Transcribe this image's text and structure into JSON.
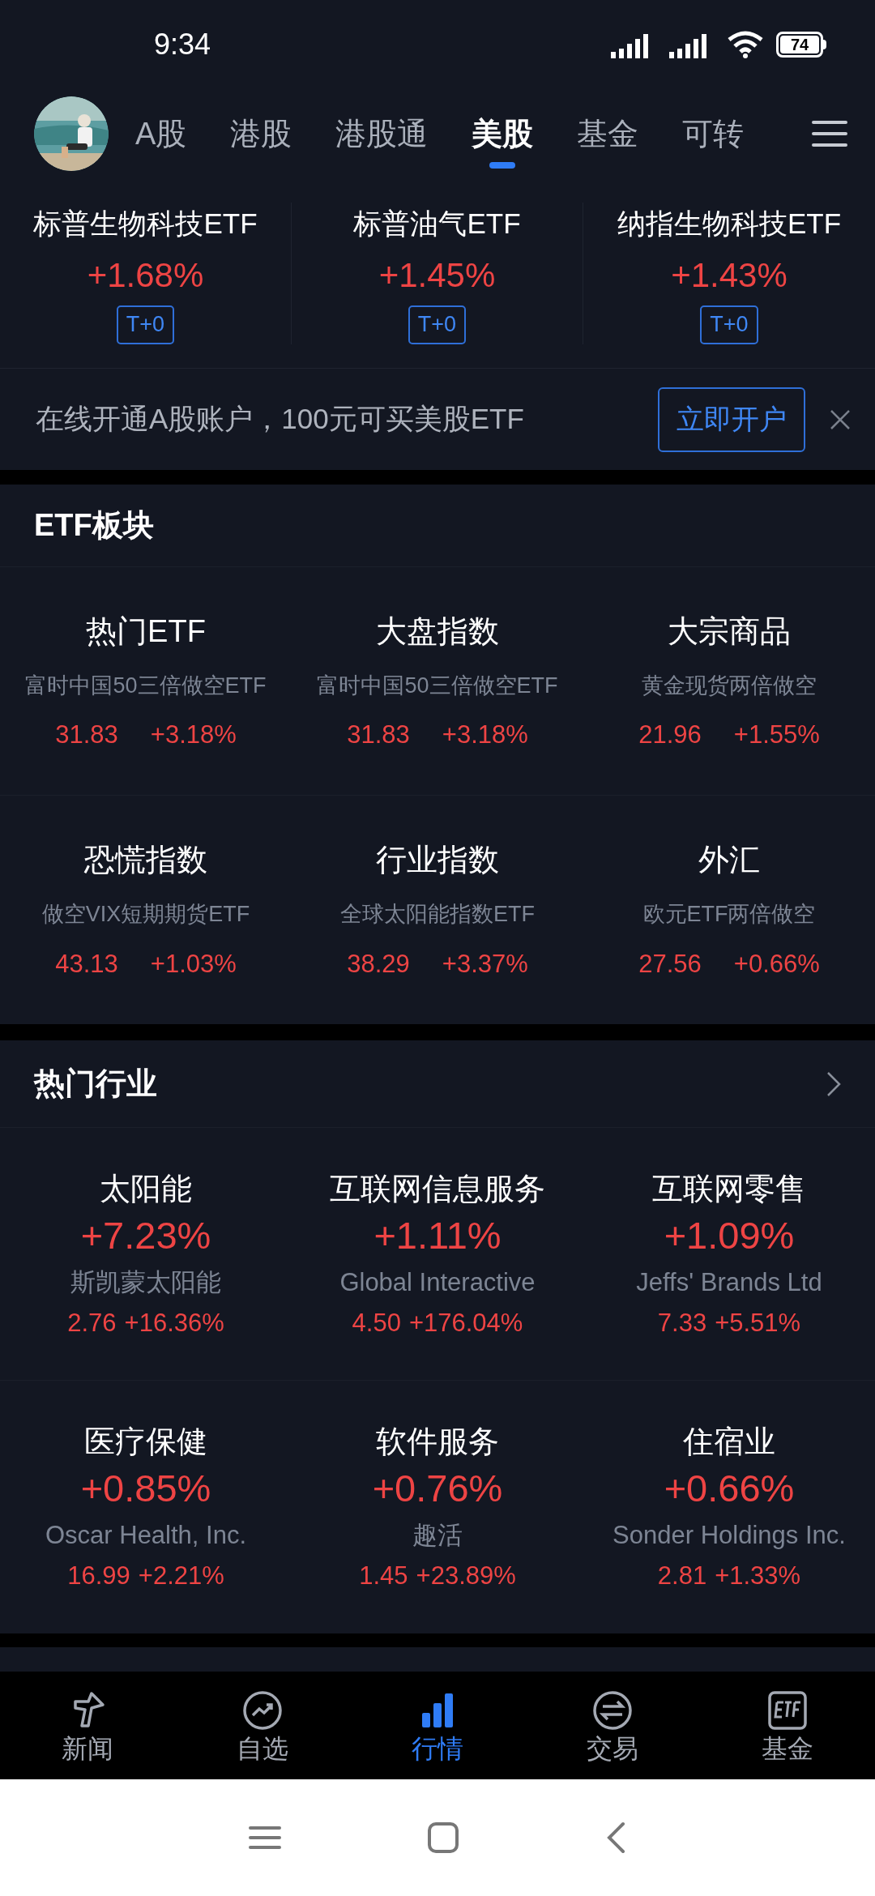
{
  "status_bar": {
    "time": "9:34",
    "battery": "74"
  },
  "market_tabs": [
    {
      "label": "A股",
      "selected": false
    },
    {
      "label": "港股",
      "selected": false
    },
    {
      "label": "港股通",
      "selected": false
    },
    {
      "label": "美股",
      "selected": true
    },
    {
      "label": "基金",
      "selected": false
    },
    {
      "label": "可转",
      "selected": false
    }
  ],
  "featured_etfs": [
    {
      "name": "标普生物科技ETF",
      "change": "+1.68%",
      "badge": "T+0"
    },
    {
      "name": "标普油气ETF",
      "change": "+1.45%",
      "badge": "T+0"
    },
    {
      "name": "纳指生物科技ETF",
      "change": "+1.43%",
      "badge": "T+0"
    }
  ],
  "banner": {
    "text": "在线开通A股账户，100元可买美股ETF",
    "button": "立即开户"
  },
  "etf_section": {
    "title": "ETF板块",
    "items": [
      {
        "name": "热门ETF",
        "fund": "富时中国50三倍做空ETF",
        "price": "31.83",
        "change": "+3.18%"
      },
      {
        "name": "大盘指数",
        "fund": "富时中国50三倍做空ETF",
        "price": "31.83",
        "change": "+3.18%"
      },
      {
        "name": "大宗商品",
        "fund": "黄金现货两倍做空",
        "price": "21.96",
        "change": "+1.55%"
      },
      {
        "name": "恐慌指数",
        "fund": "做空VIX短期期货ETF",
        "price": "43.13",
        "change": "+1.03%"
      },
      {
        "name": "行业指数",
        "fund": "全球太阳能指数ETF",
        "price": "38.29",
        "change": "+3.37%"
      },
      {
        "name": "外汇",
        "fund": "欧元ETF两倍做空",
        "price": "27.56",
        "change": "+0.66%"
      }
    ]
  },
  "hot_industries": {
    "title": "热门行业",
    "items": [
      {
        "name": "太阳能",
        "change": "+7.23%",
        "stock": "斯凯蒙太阳能",
        "price": "2.76",
        "stock_change": "+16.36%"
      },
      {
        "name": "互联网信息服务",
        "change": "+1.11%",
        "stock": "Global Interactive",
        "price": "4.50",
        "stock_change": "+176.04%"
      },
      {
        "name": "互联网零售",
        "change": "+1.09%",
        "stock": "Jeffs' Brands Ltd",
        "price": "7.33",
        "stock_change": "+5.51%"
      },
      {
        "name": "医疗保健",
        "change": "+0.85%",
        "stock": "Oscar Health, Inc.",
        "price": "16.99",
        "stock_change": "+2.21%"
      },
      {
        "name": "软件服务",
        "change": "+0.76%",
        "stock": "趣活",
        "price": "1.45",
        "stock_change": "+23.89%"
      },
      {
        "name": "住宿业",
        "change": "+0.66%",
        "stock": "Sonder Holdings Inc.",
        "price": "2.81",
        "stock_change": "+1.33%"
      }
    ]
  },
  "bottom_nav": [
    {
      "label": "新闻",
      "selected": false
    },
    {
      "label": "自选",
      "selected": false
    },
    {
      "label": "行情",
      "selected": true
    },
    {
      "label": "交易",
      "selected": false
    },
    {
      "label": "基金",
      "selected": false
    }
  ]
}
